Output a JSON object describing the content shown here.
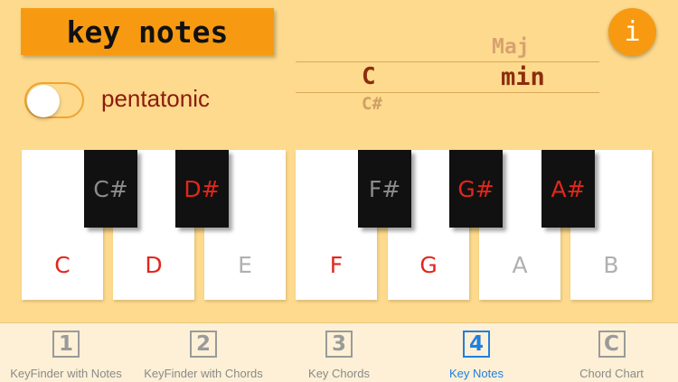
{
  "header": {
    "title": "key notes",
    "info_label": "i"
  },
  "options": {
    "pentatonic_label": "pentatonic",
    "pentatonic_on": false
  },
  "key_picker": {
    "note_options": [
      "C",
      "C#"
    ],
    "note_selected": "C",
    "mode_options": [
      "Maj",
      "min"
    ],
    "mode_selected": "min"
  },
  "keyboard": {
    "white_keys": [
      {
        "label": "C",
        "in_key": true
      },
      {
        "label": "D",
        "in_key": true
      },
      {
        "label": "E",
        "in_key": false
      },
      {
        "label": "F",
        "in_key": true
      },
      {
        "label": "G",
        "in_key": true
      },
      {
        "label": "A",
        "in_key": false
      },
      {
        "label": "B",
        "in_key": false
      }
    ],
    "black_keys": [
      {
        "label": "C#",
        "in_key": false
      },
      {
        "label": "D#",
        "in_key": true
      },
      {
        "label": "F#",
        "in_key": false
      },
      {
        "label": "G#",
        "in_key": true
      },
      {
        "label": "A#",
        "in_key": true
      }
    ],
    "colors": {
      "in_key": "#e2261c",
      "out_white": "#b0b0b0",
      "out_black": "#8c8c8c"
    }
  },
  "tabbar": {
    "tabs": [
      {
        "icon": "1",
        "label": "KeyFinder with Notes"
      },
      {
        "icon": "2",
        "label": "KeyFinder with Chords"
      },
      {
        "icon": "3",
        "label": "Key Chords"
      },
      {
        "icon": "4",
        "label": "Key Notes"
      },
      {
        "icon": "C",
        "label": "Chord Chart"
      }
    ],
    "active": "Key Notes",
    "accent": "#1f7fe0"
  }
}
